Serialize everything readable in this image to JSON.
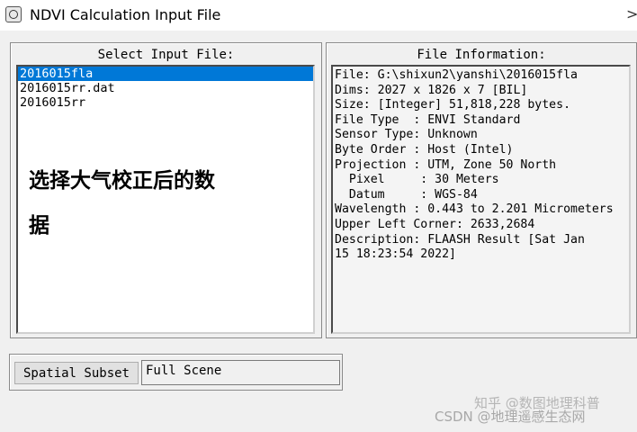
{
  "window": {
    "title": "NDVI Calculation Input File",
    "close_glyph": ">"
  },
  "select_panel": {
    "label": "Select Input File:",
    "files": [
      {
        "name": "2016015fla",
        "selected": true
      },
      {
        "name": "2016015rr.dat",
        "selected": false
      },
      {
        "name": "2016015rr",
        "selected": false
      }
    ],
    "annotation_line1": "选择大气校正后的数",
    "annotation_line2": "据"
  },
  "info_panel": {
    "label": "File Information:",
    "lines": [
      "File: G:\\shixun2\\yanshi\\2016015fla",
      "Dims: 2027 x 1826 x 7 [BIL]",
      "Size: [Integer] 51,818,228 bytes.",
      "File Type  : ENVI Standard",
      "Sensor Type: Unknown",
      "Byte Order : Host (Intel)",
      "Projection : UTM, Zone 50 North",
      "  Pixel     : 30 Meters",
      "  Datum     : WGS-84",
      "Wavelength : 0.443 to 2.201 Micrometers",
      "Upper Left Corner: 2633,2684",
      "Description: FLAASH Result [Sat Jan",
      "15 18:23:54 2022]"
    ]
  },
  "subset": {
    "button_label": "Spatial Subset",
    "value": "Full Scene"
  },
  "watermarks": {
    "line1": "知乎 @数图地理科普",
    "line2": "CSDN @地理遥感生态网"
  },
  "colors": {
    "selection": "#0078d7",
    "background": "#f0f0f0"
  }
}
